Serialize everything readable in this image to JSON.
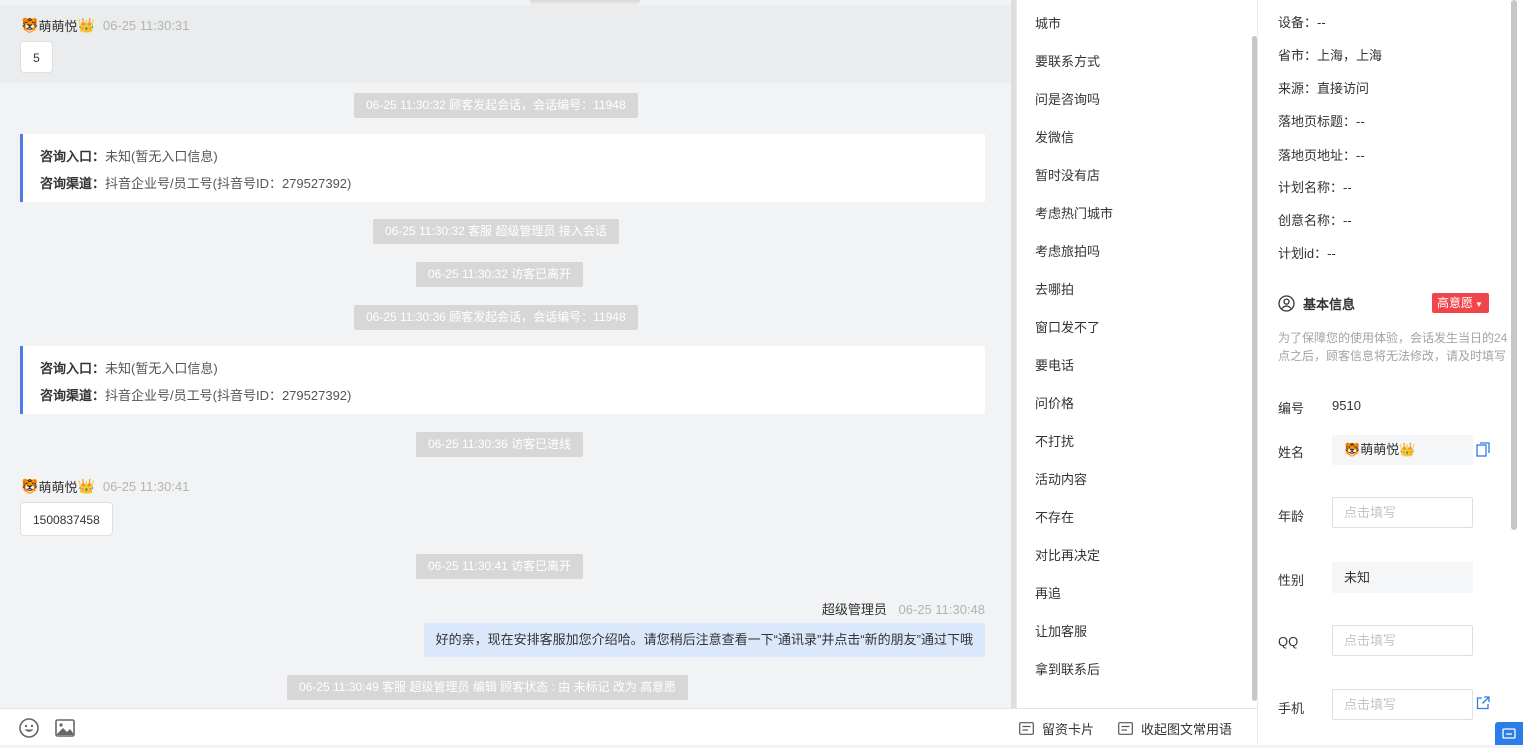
{
  "chat": {
    "messages": [
      {
        "name": "萌萌悦",
        "time": "06-25 11:30:31",
        "text": "5"
      },
      {
        "name": "萌萌悦",
        "time": "06-25 11:30:41",
        "text": "1500837458"
      }
    ],
    "system": [
      "06-25 11:30:32 顾客发起会话，会话编号：11948",
      "06-25 11:30:32 客服 超级管理员 接入会话",
      "06-25 11:30:32 访客已离开",
      "06-25 11:30:36 顾客发起会话，会话编号：11948",
      "06-25 11:30:36 访客已进线",
      "06-25 11:30:41 访客已离开",
      "06-25 11:30:49 客服 超级管理员 编辑 顾客状态 : 由 未标记 改为 高意愿"
    ],
    "info_cards": [
      {
        "entry_label": "咨询入口：",
        "entry_value": "未知(暂无入口信息)",
        "channel_label": "咨询渠道：",
        "channel_value": "抖音企业号/员工号(抖音号ID：279527392)"
      },
      {
        "entry_label": "咨询入口：",
        "entry_value": "未知(暂无入口信息)",
        "channel_label": "咨询渠道：",
        "channel_value": "抖音企业号/员工号(抖音号ID：279527392)"
      }
    ],
    "agent": {
      "name": "超级管理员",
      "time": "06-25 11:30:48",
      "text": "好的亲，现在安排客服加您介绍哈。请您稍后注意查看一下“通讯录”并点击“新的朋友”通过下哦"
    }
  },
  "toolbar": {
    "icons": [
      "emoji-icon",
      "image-icon"
    ],
    "card_label": "留资卡片",
    "collapse_label": "收起图文常用语"
  },
  "phrases": [
    "城市",
    "要联系方式",
    "问是咨询吗",
    "发微信",
    "暂时没有店",
    "考虑热门城市",
    "考虑旅拍吗",
    "去哪拍",
    "窗口发不了",
    "要电话",
    "问价格",
    "不打扰",
    "活动内容",
    "不存在",
    "对比再决定",
    "再追",
    "让加客服",
    "拿到联系后"
  ],
  "info": {
    "meta": [
      "设备：--",
      "省市：上海，上海",
      "来源：直接访问",
      "落地页标题：--",
      "落地页地址：--",
      "计划名称：--",
      "创意名称：--",
      "计划id：--"
    ],
    "basic_title": "基本信息",
    "intent": "高意愿",
    "notice": "为了保障您的使用体验，会话发生当日的24点之后，顾客信息将无法修改，请及时填写",
    "id_label": "编号",
    "id_value": "9510",
    "name_label": "姓名",
    "name_value": "萌萌悦",
    "age_label": "年龄",
    "age_placeholder": "点击填写",
    "gender_label": "性别",
    "gender_value": "未知",
    "qq_label": "QQ",
    "qq_placeholder": "点击填写",
    "phone_label": "手机",
    "phone_placeholder": "点击填写"
  },
  "colors": {
    "accent": "#4a7be8",
    "intent_badge": "#f0454b",
    "agent_bubble": "#dbe8fb",
    "system_pill": "#d7d7d7"
  }
}
